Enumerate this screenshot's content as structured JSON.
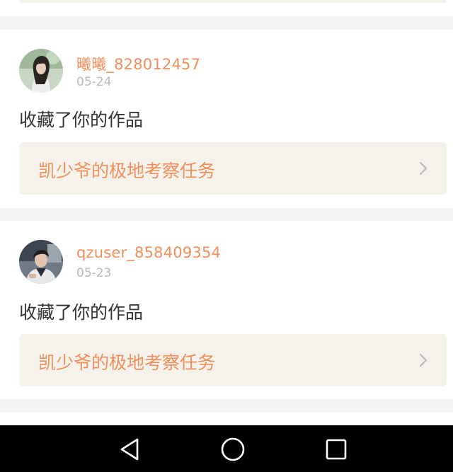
{
  "feed": {
    "items": [
      {
        "username": "曦曦_828012457",
        "date": "05-24",
        "action": "收藏了你的作品",
        "work_title": "凯少爷的极地考察任务",
        "avatar_icon": "avatar-photo-girl"
      },
      {
        "username": "qzuser_858409354",
        "date": "05-23",
        "action": "收藏了你的作品",
        "work_title": "凯少爷的极地考察任务",
        "avatar_icon": "avatar-photo-boy"
      }
    ]
  },
  "navbar": {
    "back_icon": "back-triangle-icon",
    "home_icon": "home-circle-icon",
    "recent_icon": "recent-square-icon"
  },
  "colors": {
    "accent": "#f08f5b",
    "link_bg": "#f4f2ea",
    "page_bg": "#f4f4f4",
    "navbar_bg": "#000000"
  }
}
